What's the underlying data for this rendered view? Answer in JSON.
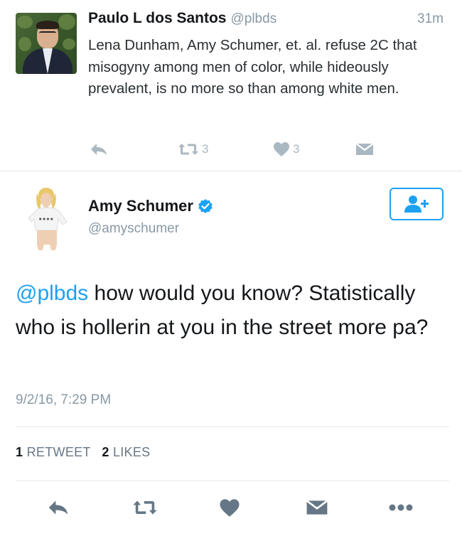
{
  "reply_tweet": {
    "name": "Paulo L dos Santos",
    "handle": "@plbds",
    "time": "31m",
    "text": "Lena Dunham, Amy Schumer, et. al. refuse 2C that misogyny among men of color, while hideously prevalent, is no more so than among white men.",
    "retweet_count": "3",
    "like_count": "3",
    "icons": [
      "reply-icon",
      "retweet-icon",
      "heart-icon",
      "message-icon"
    ]
  },
  "main_tweet": {
    "name": "Amy Schumer",
    "handle": "@amyschumer",
    "verified": true,
    "mention": "@plbds",
    "text_rest": " how would you know? Statistically who is hollerin at you in the street more pa?",
    "date": "9/2/16, 7:29 PM",
    "stats": {
      "retweets_count": "1",
      "retweets_label": "RETWEET",
      "likes_count": "2",
      "likes_label": "LIKES"
    },
    "icons": [
      "reply-icon",
      "retweet-icon",
      "heart-icon",
      "message-icon",
      "more-icon",
      "follow-icon",
      "verified-icon"
    ]
  },
  "colors": {
    "accent": "#1da1f2",
    "muted": "#8899a6",
    "icon_gray": "#657786",
    "light_icon": "#aab8c2",
    "divider": "#e1e8ed"
  }
}
